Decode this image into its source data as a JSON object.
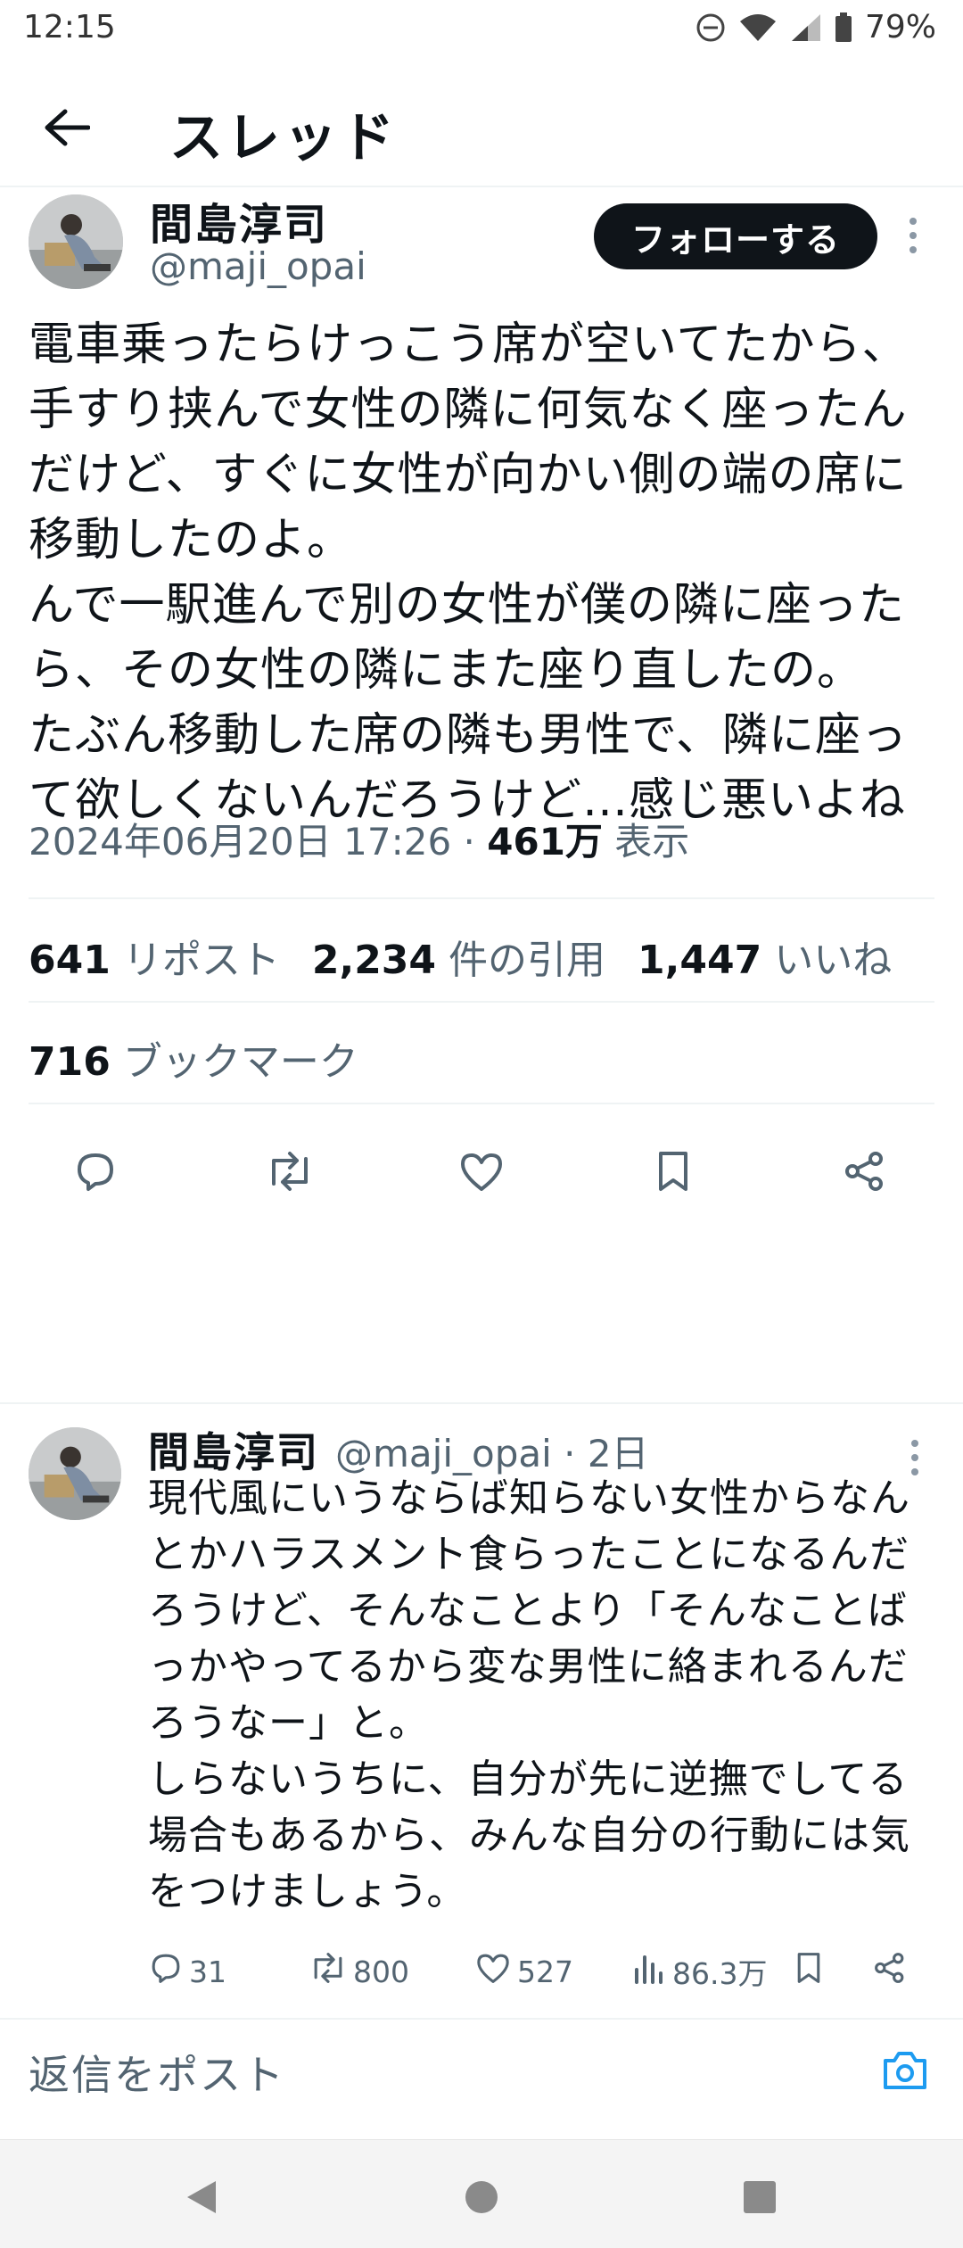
{
  "status_bar": {
    "time": "12:15",
    "battery": "79%",
    "icons": [
      "dnd-icon",
      "wifi-icon",
      "signal-icon",
      "battery-icon"
    ]
  },
  "header": {
    "title": "スレッド",
    "back_icon": "arrow-left-icon"
  },
  "main_tweet": {
    "author_name": "間島淳司",
    "author_handle": "@maji_opai",
    "follow_label": "フォローする",
    "text": "電車乗ったらけっこう席が空いてたから、手すり挟んで女性の隣に何気なく座ったんだけど、すぐに女性が向かい側の端の席に移動したのよ。\nんで一駅進んで別の女性が僕の隣に座ったら、その女性の隣にまた座り直したの。\nたぶん移動した席の隣も男性で、隣に座って欲しくないんだろうけど…感じ悪いよね",
    "timestamp": "2024年06月20日 17:26",
    "dot_separator": "·",
    "views_count": "461万",
    "views_label": "表示",
    "reposts_count": "641",
    "reposts_label": "リポスト",
    "quotes_count": "2,234",
    "quotes_label": "件の引用",
    "likes_count": "1,447",
    "likes_label": "いいね",
    "bookmarks_count": "716",
    "bookmarks_label": "ブックマーク"
  },
  "reply_tweet": {
    "author_name": "間島淳司",
    "author_handle": "@maji_opai · 2日",
    "text": "現代風にいうならば知らない女性からなんとかハラスメント食らったことになるんだろうけど、そんなことより「そんなことばっかやってるから変な男性に絡まれるんだろうなー」と。\nしらないうちに、自分が先に逆撫でしてる場合もあるから、みんな自分の行動には気をつけましょう。",
    "replies": "31",
    "reposts": "800",
    "likes": "527",
    "views": "86.3万"
  },
  "composer": {
    "placeholder": "返信をポスト"
  },
  "colors": {
    "text": "#0f1419",
    "secondary": "#536471",
    "accent": "#1d9bf0",
    "divider": "#eff3f4"
  }
}
